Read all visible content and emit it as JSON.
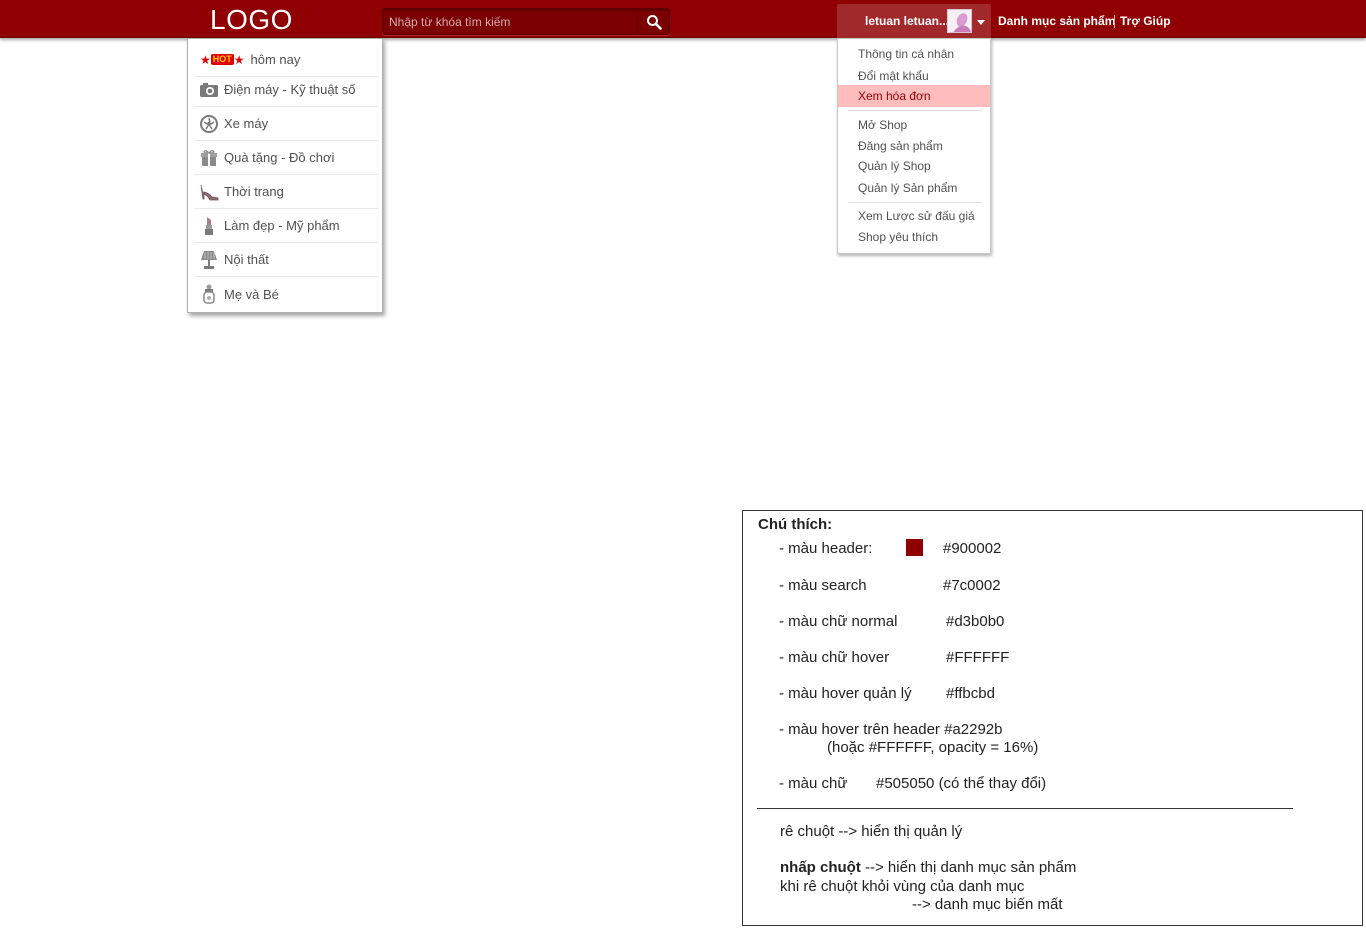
{
  "header": {
    "logo": "LOGO",
    "search_placeholder": "Nhập từ khóa tìm kiếm",
    "user_name": "letuan letuan...",
    "links": [
      "Danh mục sản phẩm",
      "Trợ Giúp"
    ]
  },
  "categories": {
    "hot_badge": "HOT",
    "items": [
      {
        "label": "hôm nay",
        "icon": "hot-star-icon"
      },
      {
        "label": "Điện máy - Kỹ thuật số",
        "icon": "camera-icon"
      },
      {
        "label": "Xe máy",
        "icon": "wheel-icon"
      },
      {
        "label": "Quà tặng - Đồ chơi",
        "icon": "gift-icon"
      },
      {
        "label": "Thời trang",
        "icon": "high-heel-icon"
      },
      {
        "label": "Làm đẹp - Mỹ phẩm",
        "icon": "lipstick-icon"
      },
      {
        "label": "Nội thất",
        "icon": "lamp-icon"
      },
      {
        "label": "Mẹ và Bé",
        "icon": "baby-bottle-icon"
      }
    ]
  },
  "user_menu": {
    "group1": [
      "Thông tin cá nhân",
      "Đổi mật khẩu",
      "Xem hóa đơn"
    ],
    "group2": [
      "Mở Shop",
      "Đăng sản phẩm",
      "Quản lý Shop",
      "Quản lý Sản phẩm"
    ],
    "group3": [
      "Xem Lược sử đấu giá",
      "Shop yêu thích"
    ],
    "active": "Xem hóa đơn"
  },
  "legend": {
    "title": "Chú thích:",
    "lines": [
      {
        "label": "- màu header:",
        "value": "#900002"
      },
      {
        "label": "- màu search",
        "value": "#7c0002"
      },
      {
        "label": "- màu chữ normal",
        "value": "#d3b0b0"
      },
      {
        "label": "- màu chữ hover",
        "value": "#FFFFFF"
      },
      {
        "label": "- màu hover quản lý",
        "value": "#ffbcbd"
      },
      {
        "label": "- màu hover trên header #a2292b",
        "value": "(hoặc #FFFFFF, opacity = 16%)"
      },
      {
        "label": "- màu chữ",
        "value": "#505050   (có thể thay đổi)"
      }
    ],
    "note_hover": "rê chuột --> hiển thị quản lý",
    "note_click_bold": "nhấp chuột",
    "note_click_rest": " --> hiển thị danh mục sản phẩm",
    "note_leave": "khi rê chuột khỏi vùng của danh mục",
    "note_result": "--> danh mục biến mất"
  },
  "colors": {
    "header": "#900002",
    "search": "#7c0002",
    "text_normal": "#d3b0b0",
    "hover_manage": "#ffbcbd",
    "hover_header": "#a2292b",
    "text": "#505050"
  }
}
